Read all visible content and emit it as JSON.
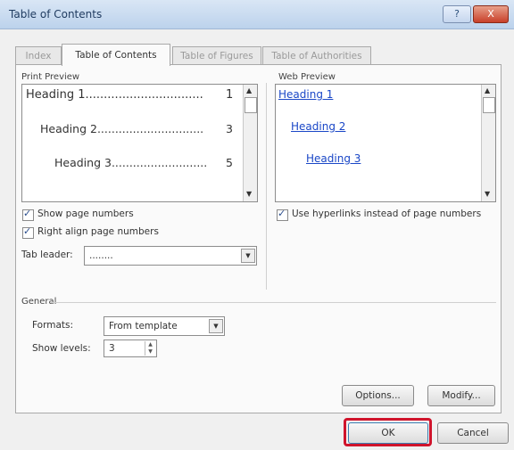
{
  "window": {
    "title": "Table of Contents",
    "help_label": "?",
    "close_label": "X"
  },
  "tabs": [
    {
      "label": "Index",
      "active": false
    },
    {
      "label": "Table of Contents",
      "active": true
    },
    {
      "label": "Table of Figures",
      "active": false
    },
    {
      "label": "Table of Authorities",
      "active": false
    }
  ],
  "print_preview": {
    "label": "Print Preview",
    "lines": [
      {
        "text": "Heading 1",
        "dots": "................................",
        "page": "1"
      },
      {
        "text": "Heading 2",
        "dots": "..............................",
        "page": "3"
      },
      {
        "text": "Heading 3",
        "dots": "...........................",
        "page": "5"
      }
    ]
  },
  "web_preview": {
    "label": "Web Preview",
    "links": [
      "Heading 1",
      "Heading 2",
      "Heading 3"
    ]
  },
  "options": {
    "show_page_numbers": {
      "label": "Show page numbers",
      "checked": true
    },
    "right_align": {
      "label": "Right align page numbers",
      "checked": true
    },
    "use_hyperlinks": {
      "label": "Use hyperlinks instead of page numbers",
      "checked": true
    },
    "tab_leader": {
      "label": "Tab leader:",
      "value": "........"
    }
  },
  "general": {
    "label": "General",
    "formats": {
      "label": "Formats:",
      "value": "From template"
    },
    "show_levels": {
      "label": "Show levels:",
      "value": "3"
    }
  },
  "buttons": {
    "options": "Options...",
    "modify": "Modify...",
    "ok": "OK",
    "cancel": "Cancel"
  },
  "colors": {
    "link": "#1a47c7",
    "highlight": "#d0142c"
  }
}
